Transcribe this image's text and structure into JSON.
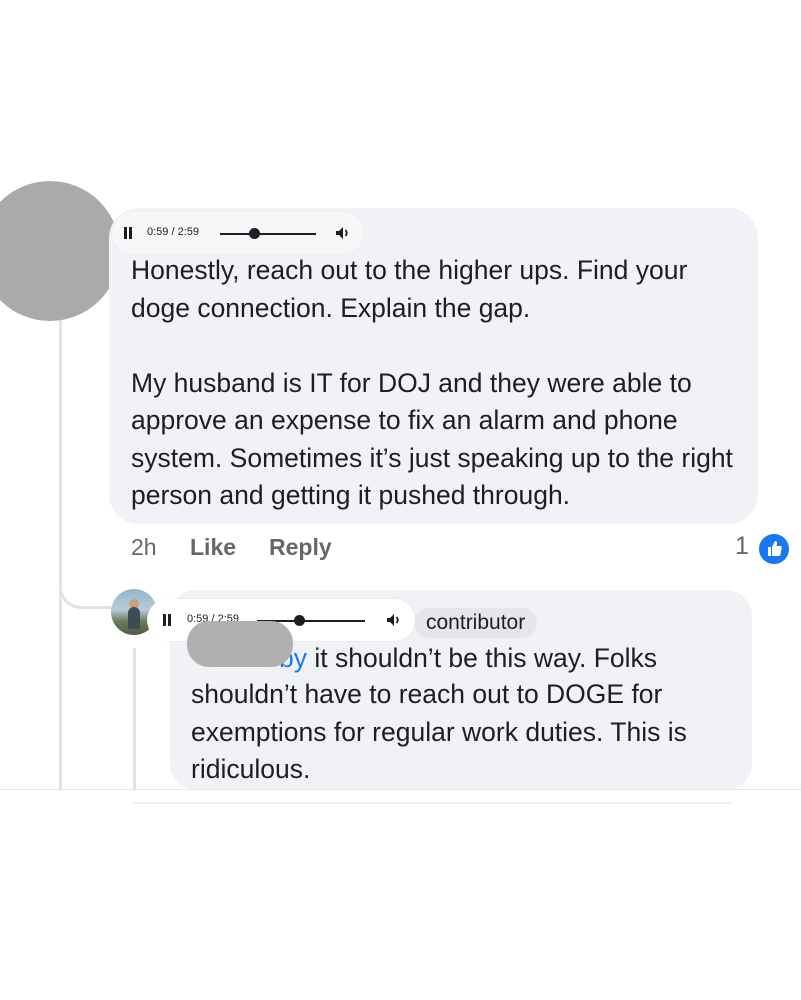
{
  "main_comment": {
    "audio": {
      "time_label": "0:59 / 2:59",
      "progress": 0.33
    },
    "text": "Honestly, reach out to the higher ups. Find your doge connection. Explain the gap.\n\nMy husband is IT for DOJ and they were able to approve an expense to fix an alarm and phone system. Sometimes it’s just speaking up to the right person and getting it pushed through.",
    "timestamp": "2h",
    "like_label": "Like",
    "reply_label": "Reply",
    "reaction_count": "1",
    "reaction_icon": "thumbs-up-icon"
  },
  "reply_comment": {
    "audio": {
      "time_label": "0:59 / 2:59",
      "progress": 0.33
    },
    "badge": "contributor",
    "mention_tail": "by",
    "first_line_rest": " it shouldn’t be this way. Folks",
    "text": "shouldn’t have to reach out to DOGE for exemptions for regular work duties. This is ridiculous."
  },
  "colors": {
    "bubble": "#f0f2f5",
    "accent": "#1877f2",
    "muted": "#65676b"
  }
}
